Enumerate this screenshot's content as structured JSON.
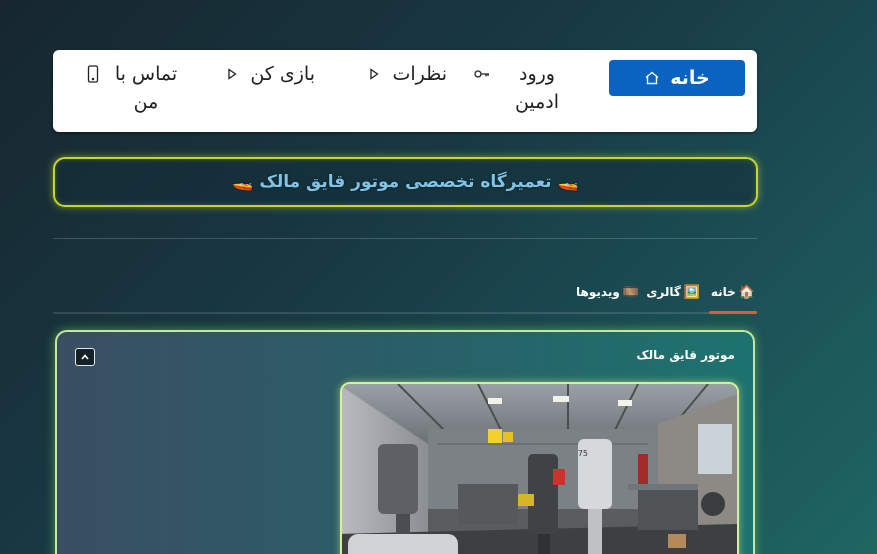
{
  "nav": {
    "items": [
      {
        "id": "home",
        "label": "خانه",
        "icon": "home-icon",
        "active": true
      },
      {
        "id": "login",
        "label": "ورود ادمین",
        "icon": "key-icon",
        "active": false
      },
      {
        "id": "reviews",
        "label": "نظرات",
        "icon": "play-icon",
        "active": false
      },
      {
        "id": "games",
        "label": "بازی کن",
        "icon": "play-icon",
        "active": false
      },
      {
        "id": "contact",
        "label": "تماس با من",
        "icon": "phone-icon",
        "active": false
      }
    ]
  },
  "banner": {
    "text": "🚤 تعمیرگاه تخصصی موتور قایق مالک 🚤"
  },
  "tabs": [
    {
      "id": "home",
      "icon": "🏠",
      "label": "خانه",
      "active": true
    },
    {
      "id": "gallery",
      "icon": "🖼️",
      "label": "گالری",
      "active": false
    },
    {
      "id": "videos",
      "icon": "🎞️",
      "label": "ویدیوها",
      "active": false
    }
  ],
  "card": {
    "title": "موتور قایق مالک",
    "collapse_icon": "chevron-up-icon",
    "photo_alt": "workshop-photo"
  },
  "colors": {
    "nav_active_bg": "#0a63c0",
    "banner_border": "#c6d62a",
    "banner_text": "#7fc3e6",
    "tab_active_underline": "#e05a3a",
    "card_glow": "#c4e6a0"
  }
}
